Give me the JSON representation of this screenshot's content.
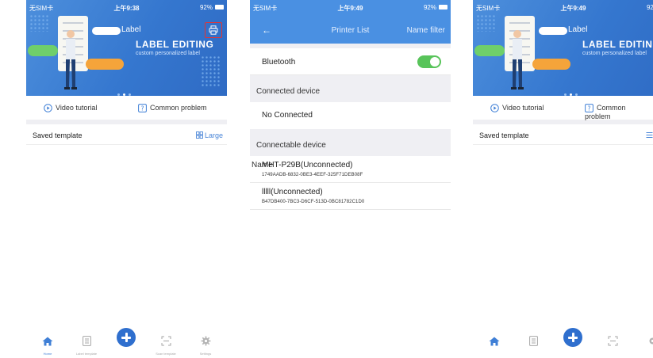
{
  "status_home": {
    "carrier": "无SIM卡",
    "time": "上午9:38",
    "battery": "92%"
  },
  "status_list": {
    "carrier": "无SIM卡",
    "time": "上午9:49",
    "battery": "92%"
  },
  "status_home2": {
    "carrier": "无SIM卡",
    "time": "上午9:49",
    "battery": "92%"
  },
  "banner": {
    "brand": "Label",
    "title": "LABEL EDITING",
    "subtitle": "custom personalized label"
  },
  "quick_links": {
    "video": "Video tutorial",
    "problem": "Common problem"
  },
  "saved": {
    "label": "Saved template",
    "view_mode": "Large"
  },
  "tabbar": {
    "home": "Home",
    "label_template": "Label template",
    "scan_template": "Scan template",
    "settings": "Settings"
  },
  "printer_list": {
    "back": "←",
    "title": "Printer List",
    "filter": "Name filter",
    "bluetooth_label": "Bluetooth",
    "connected_header": "Connected device",
    "connected_value": "No Connected",
    "connectable_header": "Connectable device",
    "devices": [
      {
        "name": "MHT-P29B(Unconnected)",
        "overlap_name": "Name",
        "uuid": "1749AADB-6832-0BE3-4EEF-325F71DEB08F"
      },
      {
        "name": "lllll(Unconnected)",
        "uuid": "B47DB400-7BC3-D6CF-513D-0BC81782C1D0"
      }
    ]
  },
  "colors": {
    "accent": "#4a90e2",
    "toggle_on": "#58c45a",
    "highlight": "#e23535"
  }
}
